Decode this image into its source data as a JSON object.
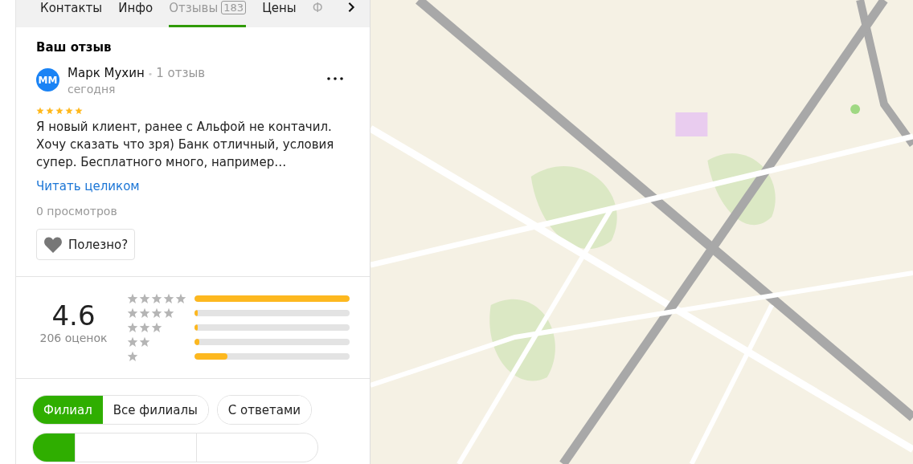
{
  "tabs": [
    {
      "label": "Контакты",
      "selected": false
    },
    {
      "label": "Инфо",
      "selected": false
    },
    {
      "label": "Отзывы",
      "count": "183",
      "selected": true
    },
    {
      "label": "Цены",
      "selected": false
    },
    {
      "label": "Ф",
      "selected": false,
      "faded": true
    }
  ],
  "my_review": {
    "heading": "Ваш отзыв",
    "avatar": "ММ",
    "author": "Марк Мухин",
    "separator": "•",
    "author_reviews": "1 отзыв",
    "date": "сегодня",
    "stars": 5,
    "text": "Я новый клиент, ранее с Альфой не контачил. Хочу сказать что зря) Банк отличный, условия супер. Бесплатного много, например…",
    "read_more": "Читать целиком",
    "views": "0 просмотров",
    "helpful": "Полезно?"
  },
  "rating": {
    "value": "4.6",
    "count": "206 оценок",
    "rows": [
      {
        "level": 1.0
      },
      {
        "level": 0.02
      },
      {
        "level": 0.02
      },
      {
        "level": 0.03
      },
      {
        "level": 0.21
      }
    ]
  },
  "filter_groups": [
    [
      {
        "label": "Филиал",
        "selected": true
      },
      {
        "label": "Все филиалы",
        "selected": false
      }
    ],
    [
      {
        "label": "С ответами",
        "selected": false
      }
    ]
  ],
  "sort_segments": [
    {
      "selected": true
    },
    {
      "selected": false
    },
    {
      "selected": false
    }
  ]
}
